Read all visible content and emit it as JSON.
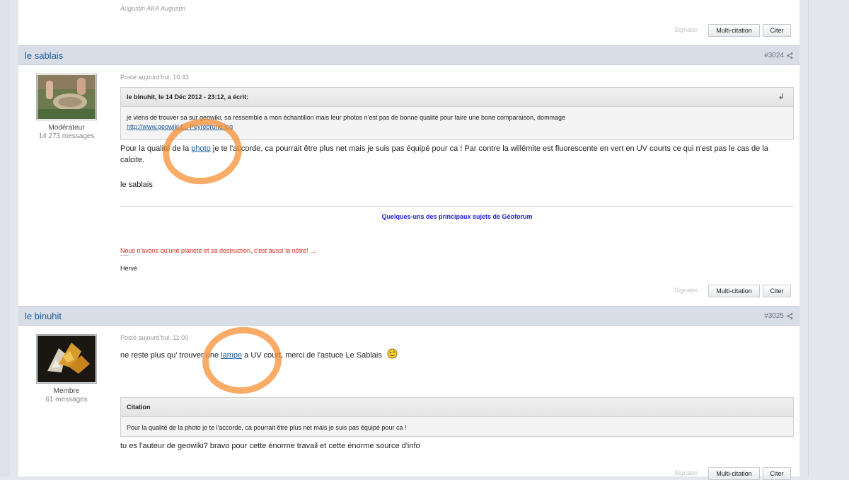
{
  "top_post": {
    "signature": "Augustin AKA Augustin",
    "actions": {
      "report": "Signaler",
      "multiquote": "Multi-citation",
      "quote": "Citer"
    }
  },
  "posts": [
    {
      "author": "le sablais",
      "post_number": "#3024",
      "role": "Modérateur",
      "message_count": "14 273 messages",
      "posted": "Posté aujourd'hui, 10:43",
      "quote": {
        "header": "le binuhit, le 14 Déc 2012 - 23:12, a écrit:",
        "body": "je viens de trouver sa sur geowiki, sa ressemble a mon échantillon mais leur photos n'est pas de bonne qualité pour faire une bone comparaison, dommage",
        "link": "http://www.geowiki.f... Peyrebrune.jpg"
      },
      "text_before_link": "Pour la qualité de la ",
      "link_word": "photo",
      "text_after_link": " je te l'accorde, ca pourrait être plus net mais je suis pas équipé pour ca ! Par contre la willémite est fluorescente en vert en UV courts ce qui n'est pas le cas de la calcite.",
      "sign_off": "le sablais",
      "signature": {
        "topics_link": "Quelques-uns des principaux sujets de Géoforum",
        "quote": "Nous n'avons qu'une planète et sa destruction, c'est aussi la nôtre! ...",
        "dash": "-----",
        "name": "Hervé"
      },
      "actions": {
        "report": "Signaler",
        "multiquote": "Multi-citation",
        "quote": "Citer"
      }
    },
    {
      "author": "le binuhit",
      "post_number": "#3025",
      "role": "Membre",
      "message_count": "61 messages",
      "posted": "Posté aujourd'hui, 11:00",
      "text_before_link": "ne reste plus qu' trouver une ",
      "link_word": "lampe",
      "text_after_link": " a UV court, merci de l'astuce Le Sablais",
      "quote": {
        "header": "Citation",
        "body": "Pour la qualité de la photo je te l'accorde, ca pourrait être plus net mais je suis pas équipé pour ca !"
      },
      "reply": "tu es l'auteur de geowiki? bravo pour cette énorme travail et cette énorme source d'info",
      "actions": {
        "report": "Signaler",
        "multiquote": "Multi-citation",
        "quote": "Citer"
      }
    }
  ],
  "colors": {
    "accent": "#1d5b96",
    "header_bar": "#d8dde8",
    "annotation": "#f68c2c",
    "signature_red": "#d8261c"
  },
  "icons": [
    "share-icon",
    "quote-arrow-icon",
    "smiley-icon"
  ]
}
